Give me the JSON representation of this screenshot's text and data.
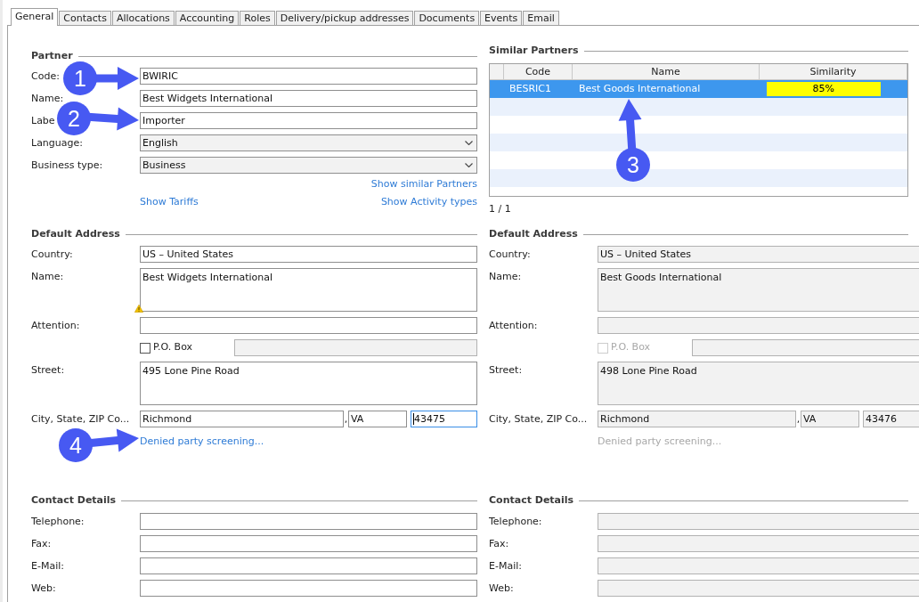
{
  "tabs": [
    {
      "label": "General",
      "selected": true
    },
    {
      "label": "Contacts",
      "selected": false
    },
    {
      "label": "Allocations",
      "selected": false
    },
    {
      "label": "Accounting",
      "selected": false
    },
    {
      "label": "Roles",
      "selected": false
    },
    {
      "label": "Delivery/pickup addresses",
      "selected": false
    },
    {
      "label": "Documents",
      "selected": false
    },
    {
      "label": "Events",
      "selected": false
    },
    {
      "label": "Email",
      "selected": false
    }
  ],
  "partner": {
    "title": "Partner",
    "fields": [
      {
        "kind": "text",
        "label": "Code:",
        "value": "BWIRIC"
      },
      {
        "kind": "text",
        "label": "Name:",
        "value": "Best Widgets International"
      },
      {
        "kind": "text",
        "label": "Labe",
        "value": "Importer"
      },
      {
        "kind": "dropdown",
        "label": "Language:",
        "value": "English"
      },
      {
        "kind": "dropdown",
        "label": "Business type:",
        "value": "Business"
      }
    ],
    "show_similar_link": "Show similar Partners",
    "show_tariffs_link": "Show Tariffs",
    "show_activity_types_link": "Show Activity types"
  },
  "similar_partners": {
    "title": "Similar Partners",
    "columns": [
      "Code",
      "Name",
      "Similarity"
    ],
    "rows": [
      {
        "code": "BESRIC1",
        "name": "Best Goods International",
        "similarity": "85%",
        "level": 0.85,
        "selected": true
      }
    ],
    "pager": "1 / 1"
  },
  "addresses": [
    {
      "title": "Default Address",
      "disabled": false,
      "fields": [
        {
          "kind": "text",
          "label": "Country:",
          "value": "US – United States"
        },
        {
          "kind": "textarea",
          "label": "Name:",
          "value": "Best Widgets International",
          "warning": true
        },
        {
          "kind": "text",
          "label": "Attention:"
        },
        {
          "kind": "checkbox",
          "label": "P.O. Box",
          "checked": false
        },
        {
          "kind": "textarea",
          "label": "Street:",
          "value": "495 Lone Pine Road",
          "warning": false
        },
        {
          "kind": "city",
          "label": "City, State, ZIP Co...",
          "city": "Richmond",
          "separator": ",",
          "state": "VA",
          "zip": "43475",
          "zip_focused": true
        }
      ],
      "screening_link": "Denied party screening..."
    },
    {
      "title": "Default Address",
      "disabled": true,
      "fields": [
        {
          "kind": "text",
          "label": "Country:",
          "value": "US – United States"
        },
        {
          "kind": "textarea",
          "label": "Name:",
          "value": "Best Goods International",
          "warning": false
        },
        {
          "kind": "text",
          "label": "Attention:"
        },
        {
          "kind": "checkbox",
          "label": "P.O. Box",
          "checked": false
        },
        {
          "kind": "textarea",
          "label": "Street:",
          "value": "498 Lone Pine Road",
          "warning": false
        },
        {
          "kind": "city",
          "label": "City, State, ZIP Co...",
          "city": "Richmond",
          "separator": ",",
          "state": "VA",
          "zip": "43476",
          "zip_focused": false
        }
      ],
      "screening_link": "Denied party screening..."
    }
  ],
  "contacts": [
    {
      "title": "Contact Details",
      "disabled": false,
      "fields": [
        {
          "label": "Telephone:"
        },
        {
          "label": "Fax:"
        },
        {
          "label": "E-Mail:"
        },
        {
          "label": "Web:"
        }
      ]
    },
    {
      "title": "Contact Details",
      "disabled": true,
      "fields": [
        {
          "label": "Telephone:"
        },
        {
          "label": "Fax:"
        },
        {
          "label": "E-Mail:"
        },
        {
          "label": "Web:"
        }
      ]
    }
  ],
  "callouts": [
    {
      "number": "1"
    },
    {
      "number": "2"
    },
    {
      "number": "3"
    },
    {
      "number": "4"
    }
  ]
}
